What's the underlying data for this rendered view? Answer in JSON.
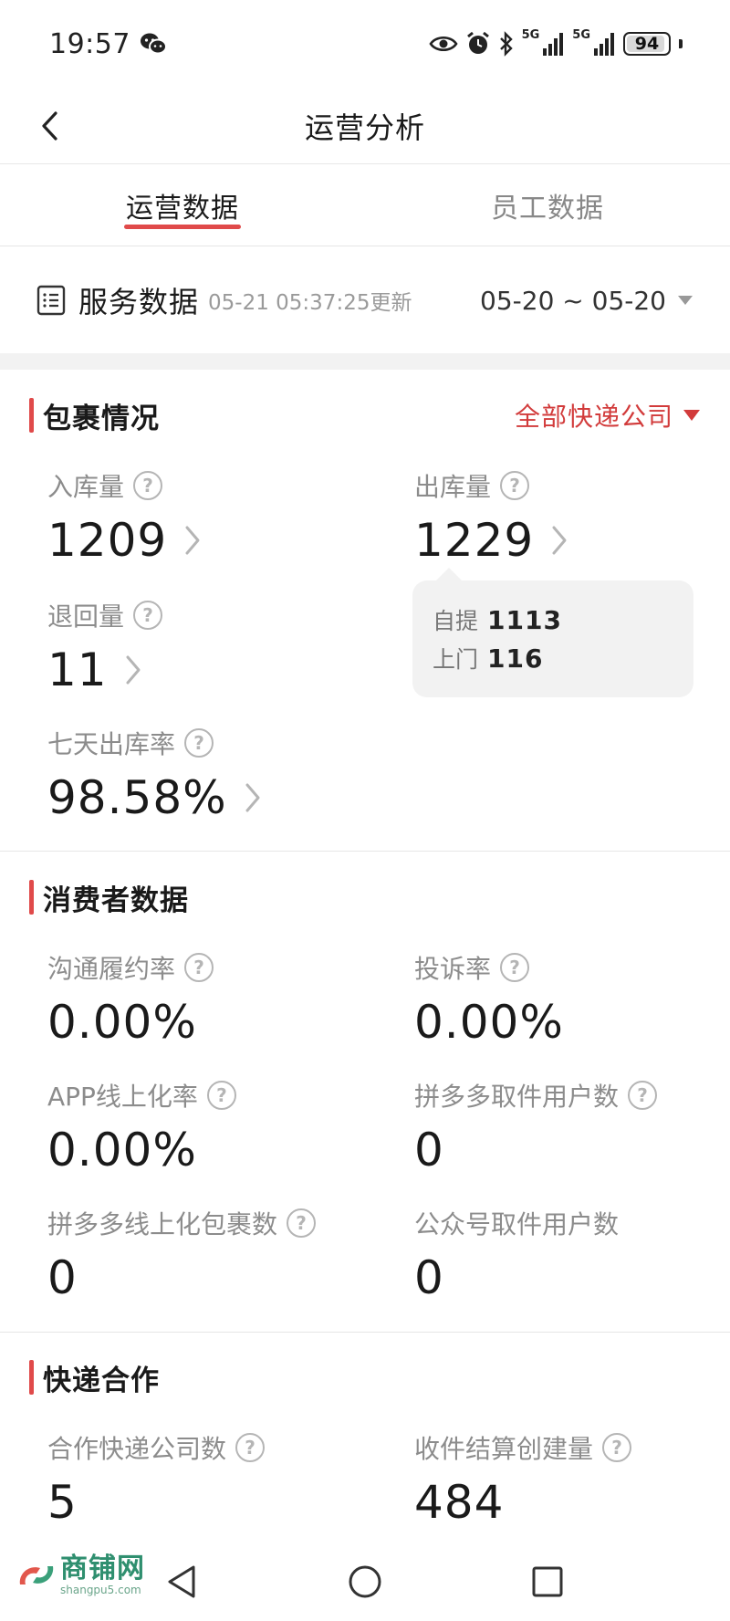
{
  "status_bar": {
    "time": "19:57",
    "signal_label_1": "5G",
    "signal_label_2": "5G",
    "battery_percent": "94",
    "battery_level": 0.94,
    "icons": [
      "wechat-icon",
      "eye-icon",
      "alarm-icon",
      "bluetooth-icon",
      "signal-icon",
      "battery-icon"
    ]
  },
  "nav": {
    "title": "运营分析"
  },
  "tabs": [
    {
      "label": "运营数据",
      "active": true
    },
    {
      "label": "员工数据",
      "active": false
    }
  ],
  "service": {
    "title": "服务数据",
    "update_text": "05-21 05:37:25更新",
    "date_range": "05-20 ~ 05-20"
  },
  "parcel": {
    "title": "包裹情况",
    "company_filter": "全部快递公司",
    "metrics": [
      {
        "label": "入库量",
        "value": "1209"
      },
      {
        "label": "出库量",
        "value": "1229"
      },
      {
        "label": "退回量",
        "value": "11"
      },
      {
        "label": "七天出库率",
        "value": "98.58%"
      }
    ],
    "tooltip": [
      {
        "label": "自提",
        "value": "1113"
      },
      {
        "label": "上门",
        "value": "116"
      }
    ]
  },
  "consumer": {
    "title": "消费者数据",
    "metrics": [
      {
        "label": "沟通履约率",
        "value": "0.00%"
      },
      {
        "label": "投诉率",
        "value": "0.00%"
      },
      {
        "label": "APP线上化率",
        "value": "0.00%"
      },
      {
        "label": "拼多多取件用户数",
        "value": "0"
      },
      {
        "label": "拼多多线上化包裹数",
        "value": "0"
      },
      {
        "label": "公众号取件用户数",
        "value": "0"
      }
    ]
  },
  "express": {
    "title": "快递合作",
    "metrics": [
      {
        "label": "合作快递公司数",
        "value": "5"
      },
      {
        "label": "收件结算创建量",
        "value": "484"
      }
    ]
  },
  "help_glyph": "?",
  "watermark": {
    "main": "商铺网",
    "sub": "shangpu5.com"
  },
  "colors": {
    "accent": "#e04a4a",
    "filter_red": "#d23b3b",
    "text_primary": "#1a1a1a",
    "text_secondary": "#8c8c8c"
  }
}
